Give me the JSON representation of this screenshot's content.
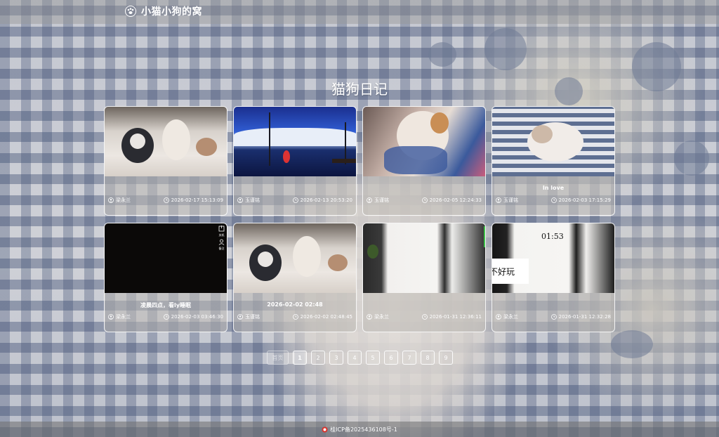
{
  "header": {
    "brand": "小猫小狗的窝"
  },
  "page": {
    "title": "猫狗日记"
  },
  "cards": [
    {
      "title": "",
      "author": "梁永兰",
      "time": "2026-02-17 15:13:09"
    },
    {
      "title": "",
      "author": "玉谨铭",
      "time": "2026-02-13 20:53:20"
    },
    {
      "title": "",
      "author": "玉谨铭",
      "time": "2026-02-05 12:24:33"
    },
    {
      "title": "In love",
      "author": "玉谨铭",
      "time": "2026-02-03 17:15:29"
    },
    {
      "title": "凌晨四点，看ly睡眠",
      "author": "梁永兰",
      "time": "2026-02-03 03:46:30"
    },
    {
      "title": "2026-02-02 02:48",
      "author": "玉谨铭",
      "time": "2026-02-02 02:48:45"
    },
    {
      "title": "",
      "author": "梁永兰",
      "time": "2026-01-31 12:36:11"
    },
    {
      "title": "",
      "author": "梁永兰",
      "time": "2026-01-31 12:32:28"
    }
  ],
  "thumb_text": {
    "card5_icon1": "关机",
    "card5_icon2": "备注",
    "card7_overlay": "不好玩",
    "card8_overlay": "01:53"
  },
  "pagination": {
    "first": "首页",
    "pages": [
      "1",
      "2",
      "3",
      "4",
      "5",
      "6",
      "7",
      "8",
      "9"
    ],
    "current": "1"
  },
  "footer": {
    "icp": "桂ICP备2025436108号-1"
  },
  "colors": {
    "accent": "#ffffff",
    "footer_icon": "#d9322b"
  }
}
